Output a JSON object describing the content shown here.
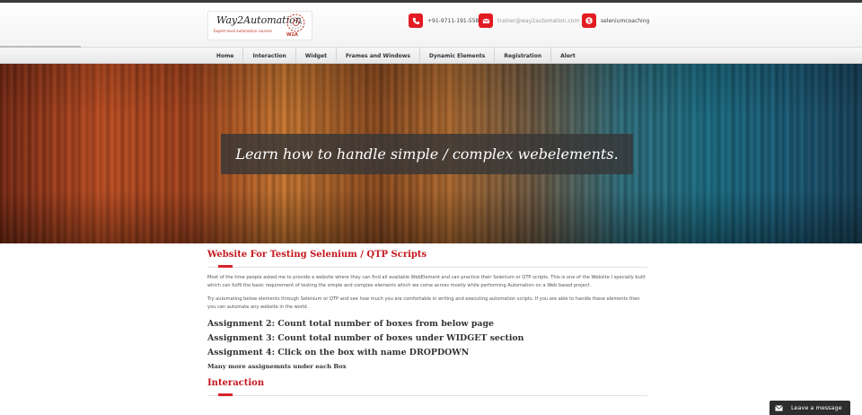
{
  "header": {
    "logo": {
      "title": "Way2Automation",
      "tagline": "Expert level automation courses",
      "mark": "W2A"
    },
    "contacts": [
      {
        "icon": "phone-icon",
        "text": "+91-9711-191-558"
      },
      {
        "icon": "mail-icon",
        "text": "trainer@way2automation.com"
      },
      {
        "icon": "skype-icon",
        "text": "seleniumcoaching"
      }
    ]
  },
  "nav": {
    "items": [
      "Home",
      "Interaction",
      "Widget",
      "Frames and Windows",
      "Dynamic Elements",
      "Registration",
      "Alert"
    ]
  },
  "banner": {
    "caption": "Learn how to handle simple / complex webelements."
  },
  "main": {
    "section_title": "Website For Testing Selenium / QTP Scripts",
    "paragraphs": [
      "Most of the time people asked me to provide a website where they can find all available WebElement and can practice their Selenium or QTP scripts. This is one of the Website I specially built which can fulfil the basic requirement of testing the simple and complex elements which we come across mostly while performing Automation on a Web based project .",
      "Try automating below elements through Selenium or QTP and see how much you are comfortable in writing and executing automation scripts. If you are able to handle these elements then you can automate any website in the world."
    ],
    "assignments": [
      "Assignment 2: Count total number of boxes from below page",
      "Assignment 3: Count total number of boxes under WIDGET section",
      "Assignment 4: Click on the box with name DROPDOWN"
    ],
    "more_note": "Many more assignemnts under each Box",
    "next_section_title": "Interaction"
  },
  "chat": {
    "label": "Leave a message",
    "icon": "envelope-icon"
  },
  "colors": {
    "brand_red": "#c4161c",
    "icon_red": "#e31b23",
    "caption_bg": "#373737",
    "chat_bg": "#2d2d2d"
  }
}
